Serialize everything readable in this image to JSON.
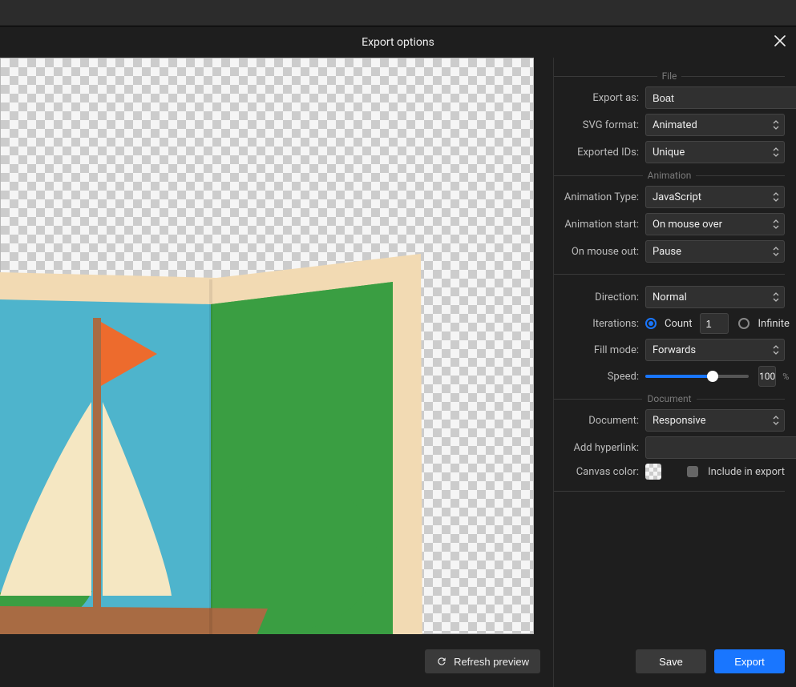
{
  "dialog": {
    "title": "Export options"
  },
  "sections": {
    "file": "File",
    "animation": "Animation",
    "document": "Document"
  },
  "labels": {
    "export_as": "Export as:",
    "svg_format": "SVG format:",
    "exported_ids": "Exported IDs:",
    "animation_type": "Animation Type:",
    "animation_start": "Animation start:",
    "on_mouse_out": "On mouse out:",
    "direction": "Direction:",
    "iterations": "Iterations:",
    "count": "Count",
    "infinite": "Infinite",
    "fill_mode": "Fill mode:",
    "speed": "Speed:",
    "speed_unit": "%",
    "document": "Document:",
    "add_hyperlink": "Add hyperlink:",
    "canvas_color": "Canvas color:",
    "include_in_export": "Include in export"
  },
  "values": {
    "export_as": "Boat",
    "svg_format": "Animated",
    "exported_ids": "Unique",
    "animation_type": "JavaScript",
    "animation_start": "On mouse over",
    "on_mouse_out": "Pause",
    "direction": "Normal",
    "iterations_mode": "count",
    "iterations_count": "1",
    "fill_mode": "Forwards",
    "speed": 100,
    "speed_display": "100",
    "document": "Responsive",
    "add_hyperlink": "",
    "include_in_export": false
  },
  "buttons": {
    "refresh_preview": "Refresh preview",
    "save": "Save",
    "export": "Export"
  }
}
